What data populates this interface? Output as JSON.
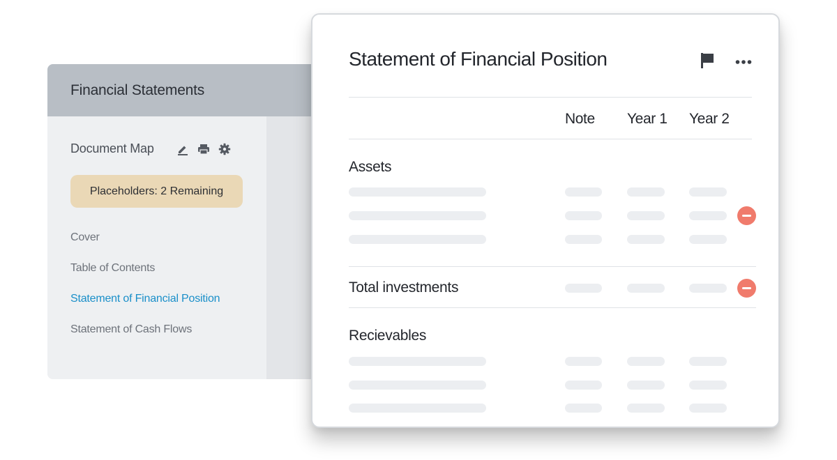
{
  "back_panel": {
    "header_title": "Financial Statements",
    "document_map": {
      "title": "Document Map",
      "icons": [
        "edit-icon",
        "print-icon",
        "gear-icon"
      ]
    },
    "placeholder_badge": "Placeholders: 2 Remaining",
    "nav_items": [
      {
        "label": "Cover",
        "active": false
      },
      {
        "label": "Table of Contents",
        "active": false
      },
      {
        "label": "Statement of Financial Position",
        "active": true
      },
      {
        "label": "Statement of Cash Flows",
        "active": false
      }
    ]
  },
  "card": {
    "title": "Statement of Financial Position",
    "header_icons": [
      "flag-icon",
      "more-icon"
    ],
    "columns": {
      "note": "Note",
      "year1": "Year 1",
      "year2": "Year 2"
    },
    "sections": {
      "assets": "Assets",
      "total_investments": "Total investments",
      "receivables": "Recievables"
    }
  },
  "colors": {
    "accent_link": "#1a8fc9",
    "remove_button": "#f07b6c",
    "badge_bg": "#ead8b6",
    "header_bg": "#b8bec5"
  }
}
